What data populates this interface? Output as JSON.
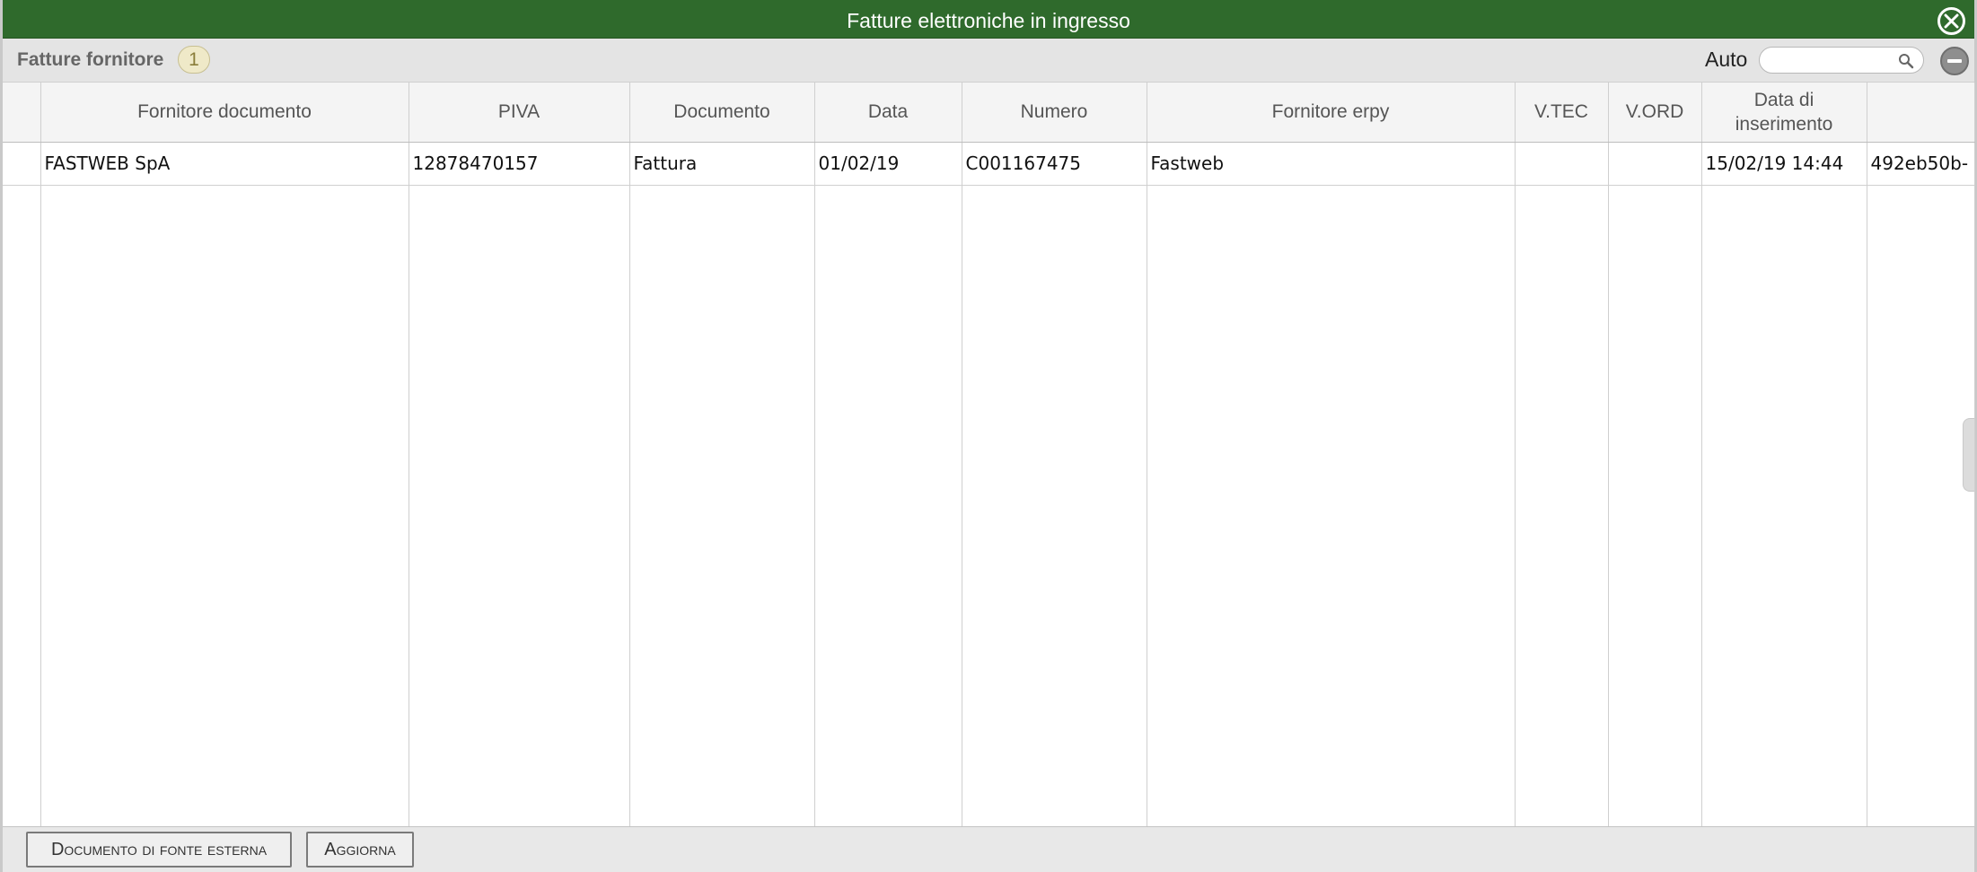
{
  "window": {
    "title": "Fatture elettroniche in ingresso",
    "close_icon": "close-circle-icon"
  },
  "toolbar": {
    "section_title": "Fatture fornitore",
    "count": "1",
    "auto_label": "Auto",
    "search_value": "",
    "search_icon": "magnifier-icon",
    "minus_icon": "minus-circle-icon"
  },
  "table": {
    "columns": [
      "",
      "Fornitore documento",
      "PIVA",
      "Documento",
      "Data",
      "Numero",
      "Fornitore erpy",
      "V.TEC",
      "V.ORD",
      "Data di inserimento",
      ""
    ],
    "rows": [
      [
        "",
        "FASTWEB SpA",
        "12878470157",
        "Fattura",
        "01/02/19",
        "C001167475",
        "Fastweb",
        "",
        "",
        "15/02/19 14:44",
        "492eb50b-"
      ]
    ]
  },
  "footer": {
    "external_doc_button": "Documento di fonte esterna",
    "refresh_button": "Aggiorna"
  },
  "colors": {
    "titlebar": "#2f6a2c",
    "badge_bg": "#efe9c8"
  }
}
